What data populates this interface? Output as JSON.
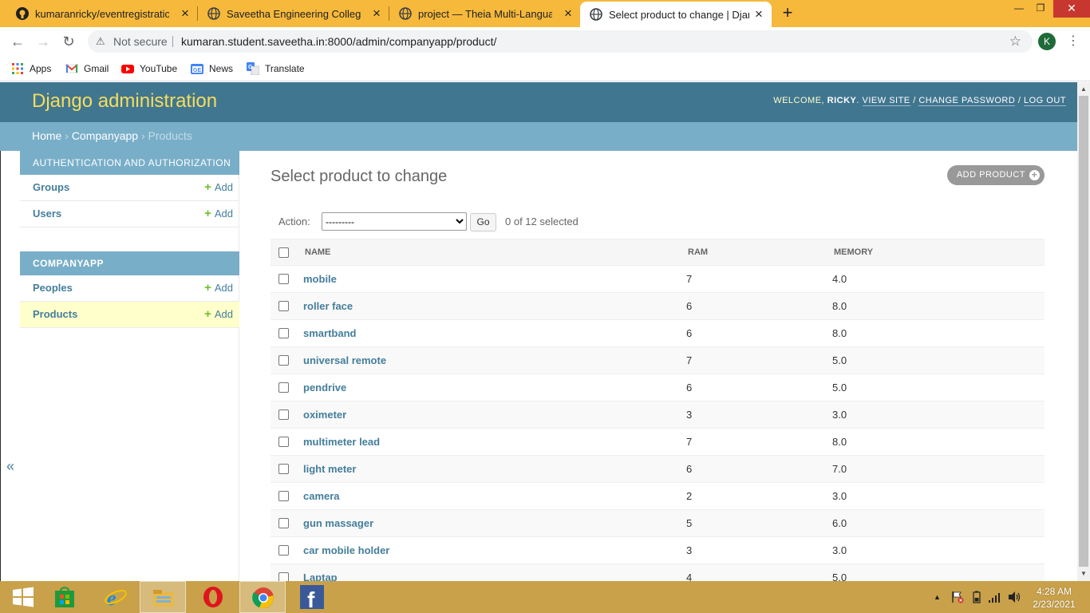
{
  "browser": {
    "tabs": [
      {
        "title": "kumaranricky/eventregistration",
        "icon": "github-icon",
        "active": false
      },
      {
        "title": "Saveetha Engineering College",
        "icon": "globe-icon",
        "active": false
      },
      {
        "title": "project — Theia Multi-Language",
        "icon": "globe-icon",
        "active": false
      },
      {
        "title": "Select product to change | Djang",
        "icon": "globe-icon",
        "active": true
      }
    ],
    "security_label": "Not secure",
    "url": "kumaran.student.saveetha.in:8000/admin/companyapp/product/",
    "profile_initial": "K",
    "bookmarks": [
      {
        "label": "Apps",
        "icon": "apps-grid-icon"
      },
      {
        "label": "Gmail",
        "icon": "gmail-icon"
      },
      {
        "label": "YouTube",
        "icon": "youtube-icon"
      },
      {
        "label": "News",
        "icon": "news-icon"
      },
      {
        "label": "Translate",
        "icon": "translate-icon"
      }
    ]
  },
  "admin": {
    "brand": "Django administration",
    "user": {
      "welcome": "Welcome,",
      "name": "Ricky",
      "view_site": "View site",
      "change_password": "Change password",
      "log_out": "Log out"
    },
    "breadcrumbs": {
      "home": "Home",
      "app": "Companyapp",
      "current": "Products"
    },
    "sidebar": {
      "modules": [
        {
          "caption": "Authentication and Authorization",
          "rows": [
            {
              "label": "Groups",
              "add": "Add"
            },
            {
              "label": "Users",
              "add": "Add"
            }
          ]
        },
        {
          "caption": "Companyapp",
          "rows": [
            {
              "label": "Peoples",
              "add": "Add"
            },
            {
              "label": "Products",
              "add": "Add",
              "current": true
            }
          ]
        }
      ],
      "collapse_glyph": "«"
    },
    "page_title": "Select product to change",
    "add_button": "Add product",
    "actions": {
      "label": "Action:",
      "selected_option": "---------",
      "go": "Go",
      "counter": "0 of 12 selected"
    },
    "table": {
      "columns": [
        "Name",
        "RAM",
        "Memory"
      ],
      "rows": [
        {
          "name": "mobile",
          "ram": "7",
          "memory": "4.0"
        },
        {
          "name": "roller face",
          "ram": "6",
          "memory": "8.0"
        },
        {
          "name": "smartband",
          "ram": "6",
          "memory": "8.0"
        },
        {
          "name": "universal remote",
          "ram": "7",
          "memory": "5.0"
        },
        {
          "name": "pendrive",
          "ram": "6",
          "memory": "5.0"
        },
        {
          "name": "oximeter",
          "ram": "3",
          "memory": "3.0"
        },
        {
          "name": "multimeter lead",
          "ram": "7",
          "memory": "8.0"
        },
        {
          "name": "light meter",
          "ram": "6",
          "memory": "7.0"
        },
        {
          "name": "camera",
          "ram": "2",
          "memory": "3.0"
        },
        {
          "name": "gun massager",
          "ram": "5",
          "memory": "6.0"
        },
        {
          "name": "car mobile holder",
          "ram": "3",
          "memory": "3.0"
        },
        {
          "name": "Laptap",
          "ram": "4",
          "memory": "5.0"
        }
      ]
    }
  },
  "taskbar": {
    "apps": [
      "windows-start-icon",
      "store-icon",
      "internet-explorer-icon",
      "file-explorer-icon",
      "opera-icon",
      "chrome-icon",
      "facebook-icon"
    ],
    "time": "4:28 AM",
    "date": "2/23/2021"
  },
  "colors": {
    "header": "#417690",
    "breadcrumbs": "#79aec8",
    "brand": "#f5dd5d",
    "link": "#447e9b",
    "add_green": "#70bf2b",
    "tab_strip": "#f6b93b",
    "taskbar": "#c8a14a"
  }
}
